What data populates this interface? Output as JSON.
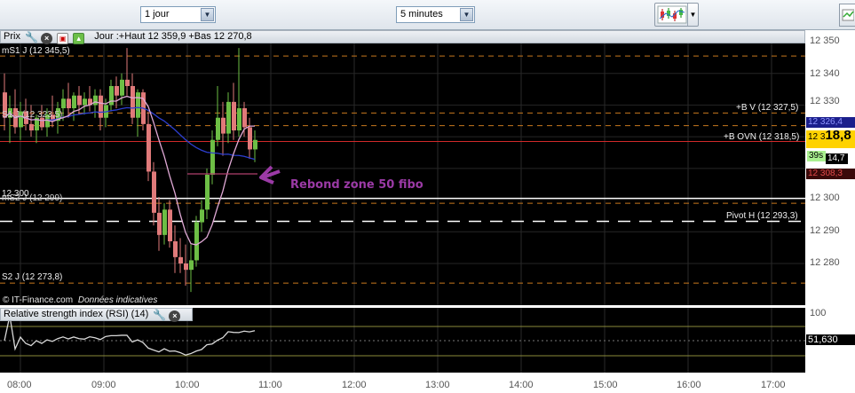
{
  "toolbar": {
    "period_value": "1 jour",
    "interval_value": "5 minutes",
    "charttype_icon": "candlestick-chart-icon",
    "arrow_icon": "chevron-down-icon"
  },
  "price_panel": {
    "title": "Prix",
    "summary": "Jour :+Haut 12 359,9 +Bas 12 270,8",
    "watermark": "© IT-Finance.com",
    "watermark_note": "Données indicatives",
    "levels": {
      "ms1": "mS1 J (12 345,5)",
      "s1": "S1 J (12 323,5)",
      "ms2": "mS2 J (12 299)",
      "s2": "S2 J (12 273,8)",
      "bv": "+B V (12 327,5)",
      "bovn": "+B OVN (12 318,5)",
      "pivot": "Pivot H (12 293,3)",
      "round": "12 300"
    },
    "annotation": "Rebond zone 50 fibo"
  },
  "price_axis": {
    "ticks": [
      "12 350",
      "12 340",
      "12 330",
      "12 320",
      "12 310",
      "12 300",
      "12 290",
      "12 280"
    ],
    "box_upper": "12 326,4",
    "box_price_small": "12 3",
    "box_price_big": "18,8",
    "countdown": "39s",
    "box_side": "14,7",
    "box_lower": "12 308,3"
  },
  "rsi_panel": {
    "title": "Relative strength index (RSI) (14)",
    "value": "51,630",
    "axis_top": "100"
  },
  "time_axis": {
    "ticks": [
      "08:00",
      "09:00",
      "10:00",
      "11:00",
      "12:00",
      "13:00",
      "14:00",
      "15:00",
      "16:00",
      "17:00"
    ]
  },
  "colors": {
    "up_candle": "#6dbe45",
    "down_candle": "#e07a7a",
    "ma_blue": "#2d3fd0",
    "ma_pink": "#e0a9d5",
    "annotation": "#9b3aa6",
    "level_orange": "#c8781e"
  },
  "chart_data": {
    "type": "candlestick",
    "interval": "5 minutes",
    "candles": [
      {
        "o": 12334,
        "h": 12340,
        "l": 12322,
        "c": 12326
      },
      {
        "o": 12326,
        "h": 12333,
        "l": 12318,
        "c": 12329
      },
      {
        "o": 12329,
        "h": 12335,
        "l": 12321,
        "c": 12323
      },
      {
        "o": 12323,
        "h": 12331,
        "l": 12319,
        "c": 12328
      },
      {
        "o": 12328,
        "h": 12332,
        "l": 12322,
        "c": 12324
      },
      {
        "o": 12324,
        "h": 12330,
        "l": 12320,
        "c": 12322
      },
      {
        "o": 12322,
        "h": 12327,
        "l": 12318,
        "c": 12326
      },
      {
        "o": 12326,
        "h": 12330,
        "l": 12322,
        "c": 12323
      },
      {
        "o": 12323,
        "h": 12329,
        "l": 12320,
        "c": 12327
      },
      {
        "o": 12327,
        "h": 12333,
        "l": 12323,
        "c": 12325
      },
      {
        "o": 12325,
        "h": 12331,
        "l": 12321,
        "c": 12329
      },
      {
        "o": 12329,
        "h": 12335,
        "l": 12325,
        "c": 12332
      },
      {
        "o": 12332,
        "h": 12337,
        "l": 12326,
        "c": 12329
      },
      {
        "o": 12329,
        "h": 12334,
        "l": 12325,
        "c": 12333
      },
      {
        "o": 12333,
        "h": 12336,
        "l": 12327,
        "c": 12330
      },
      {
        "o": 12330,
        "h": 12334,
        "l": 12327,
        "c": 12332
      },
      {
        "o": 12332,
        "h": 12336,
        "l": 12328,
        "c": 12330
      },
      {
        "o": 12330,
        "h": 12335,
        "l": 12326,
        "c": 12333
      },
      {
        "o": 12333,
        "h": 12335,
        "l": 12322,
        "c": 12326
      },
      {
        "o": 12326,
        "h": 12332,
        "l": 12323,
        "c": 12330
      },
      {
        "o": 12330,
        "h": 12338,
        "l": 12328,
        "c": 12336
      },
      {
        "o": 12336,
        "h": 12339,
        "l": 12329,
        "c": 12333
      },
      {
        "o": 12333,
        "h": 12340,
        "l": 12330,
        "c": 12338
      },
      {
        "o": 12338,
        "h": 12348,
        "l": 12333,
        "c": 12336
      },
      {
        "o": 12336,
        "h": 12340,
        "l": 12324,
        "c": 12326
      },
      {
        "o": 12326,
        "h": 12335,
        "l": 12320,
        "c": 12334
      },
      {
        "o": 12334,
        "h": 12335,
        "l": 12322,
        "c": 12324
      },
      {
        "o": 12324,
        "h": 12328,
        "l": 12306,
        "c": 12309
      },
      {
        "o": 12309,
        "h": 12312,
        "l": 12292,
        "c": 12296
      },
      {
        "o": 12296,
        "h": 12301,
        "l": 12284,
        "c": 12289
      },
      {
        "o": 12289,
        "h": 12299,
        "l": 12286,
        "c": 12297
      },
      {
        "o": 12297,
        "h": 12300,
        "l": 12285,
        "c": 12287
      },
      {
        "o": 12287,
        "h": 12292,
        "l": 12277,
        "c": 12282
      },
      {
        "o": 12282,
        "h": 12288,
        "l": 12277,
        "c": 12280
      },
      {
        "o": 12280,
        "h": 12286,
        "l": 12273,
        "c": 12278
      },
      {
        "o": 12278,
        "h": 12286,
        "l": 12271,
        "c": 12281
      },
      {
        "o": 12281,
        "h": 12295,
        "l": 12279,
        "c": 12293
      },
      {
        "o": 12293,
        "h": 12300,
        "l": 12290,
        "c": 12297
      },
      {
        "o": 12297,
        "h": 12310,
        "l": 12294,
        "c": 12308
      },
      {
        "o": 12308,
        "h": 12322,
        "l": 12305,
        "c": 12319
      },
      {
        "o": 12319,
        "h": 12336,
        "l": 12317,
        "c": 12326
      },
      {
        "o": 12326,
        "h": 12331,
        "l": 12314,
        "c": 12321
      },
      {
        "o": 12321,
        "h": 12334,
        "l": 12318,
        "c": 12331
      },
      {
        "o": 12331,
        "h": 12337,
        "l": 12319,
        "c": 12322
      },
      {
        "o": 12322,
        "h": 12348,
        "l": 12320,
        "c": 12329
      },
      {
        "o": 12329,
        "h": 12331,
        "l": 12320,
        "c": 12323
      },
      {
        "o": 12323,
        "h": 12326,
        "l": 12313,
        "c": 12316
      },
      {
        "o": 12316,
        "h": 12322,
        "l": 12312,
        "c": 12319
      }
    ],
    "price_range": [
      12270,
      12356
    ],
    "rsi_value": 51.63
  }
}
